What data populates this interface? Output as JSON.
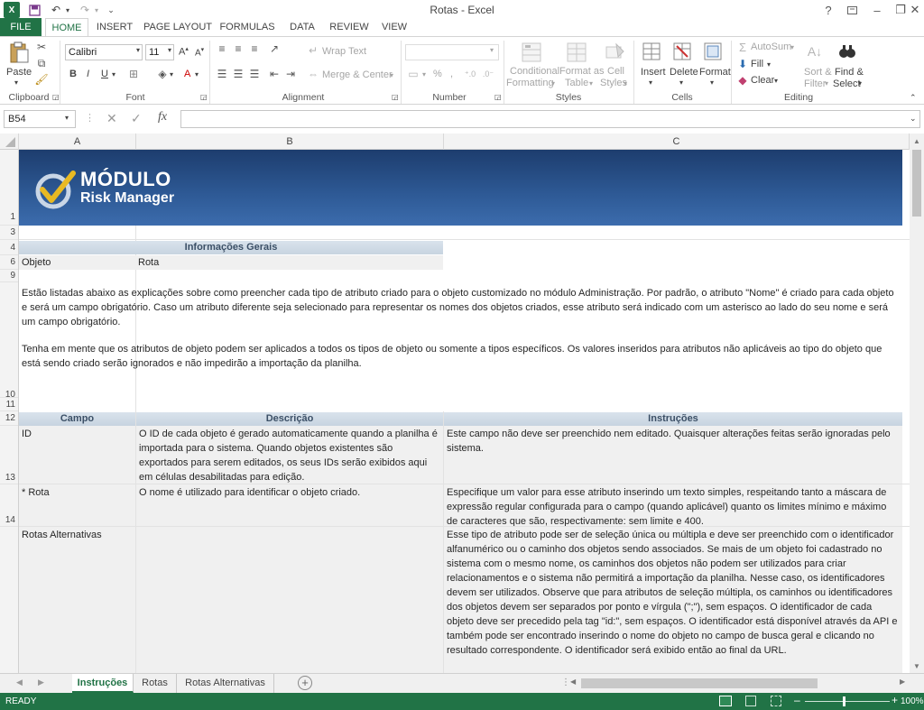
{
  "window": {
    "title": "Rotas - Excel"
  },
  "ribbon_tabs": [
    "FILE",
    "HOME",
    "INSERT",
    "PAGE LAYOUT",
    "FORMULAS",
    "DATA",
    "REVIEW",
    "VIEW"
  ],
  "clipboard": {
    "paste": "Paste",
    "label": "Clipboard"
  },
  "font": {
    "name": "Calibri",
    "size": "11",
    "bold": "B",
    "italic": "I",
    "underline": "U",
    "label": "Font"
  },
  "alignment": {
    "wrap_text": "Wrap Text",
    "merge_center": "Merge & Center",
    "label": "Alignment"
  },
  "number": {
    "percent": "%",
    "comma": ",",
    "label": "Number"
  },
  "styles": {
    "conditional": "Conditional",
    "formatting": "Formatting",
    "format_as": "Format as",
    "table": "Table",
    "cell": "Cell",
    "cell_styles": "Styles",
    "label": "Styles"
  },
  "cells": {
    "insert": "Insert",
    "delete": "Delete",
    "format": "Format",
    "label": "Cells"
  },
  "editing": {
    "autosum": "AutoSum",
    "fill": "Fill",
    "clear": "Clear",
    "sort": "Sort &",
    "filter": "Filter",
    "find": "Find &",
    "select": "Select",
    "label": "Editing"
  },
  "formula_bar": {
    "name_box": "B54",
    "fx": "fx",
    "value": ""
  },
  "columns": [
    "A",
    "B",
    "C"
  ],
  "rows": [
    "1",
    "3",
    "4",
    "6",
    "9",
    "10",
    "11",
    "12",
    "13",
    "14"
  ],
  "logo": {
    "line1": "MÓDULO",
    "line2": "Risk Manager"
  },
  "info": {
    "header": "Informações Gerais",
    "objeto_label": "Objeto",
    "objeto_value": "Rota"
  },
  "intro": {
    "p1": "Estão listadas abaixo as explicações sobre como preencher cada tipo de atributo criado para o objeto customizado no módulo Administração. Por padrão, o atributo \"Nome\" é criado para cada objeto e será um campo obrigatório. Caso um atributo diferente seja selecionado para representar os nomes dos objetos criados, esse atributo será indicado com um asterisco ao lado do seu nome e será um campo obrigatório.",
    "p2": "Tenha em mente que os atributos de objeto podem ser aplicados a todos os tipos de objeto ou somente a tipos específicos. Os valores inseridos para atributos não aplicáveis ao tipo do objeto que está sendo criado serão ignorados e não impedirão a importação da planilha."
  },
  "table": {
    "headers": [
      "Campo",
      "Descrição",
      "Instruções"
    ],
    "rows": [
      {
        "campo": "ID",
        "descricao": "O ID de cada objeto é gerado automaticamente quando a planilha é importada para o sistema. Quando objetos existentes são exportados para serem editados, os seus IDs serão exibidos aqui em células desabilitadas para edição.",
        "instrucoes": "Este campo não deve ser preenchido nem editado. Quaisquer alterações feitas serão ignoradas pelo sistema."
      },
      {
        "campo": "* Rota",
        "descricao": "O nome é utilizado para identificar o objeto criado.",
        "instrucoes": "Especifique um valor para esse atributo inserindo um texto simples, respeitando tanto a máscara de expressão regular configurada para o campo (quando aplicável) quanto os limites mínimo e máximo de caracteres que são, respectivamente: sem limite e 400."
      },
      {
        "campo": "Rotas Alternativas",
        "descricao": "",
        "instrucoes": "Esse tipo de atributo pode ser de seleção única ou múltipla e deve ser preenchido com o identificador alfanumérico ou o caminho dos objetos sendo associados. Se mais de um objeto foi cadastrado no sistema com o mesmo nome, os caminhos dos objetos não podem ser utilizados para criar relacionamentos e o sistema não permitirá a importação da planilha. Nesse caso, os identificadores devem ser utilizados. Observe que para atributos de seleção múltipla, os caminhos ou identificadores dos objetos devem ser separados por ponto e vírgula (\";\"), sem espaços. O identificador de cada objeto deve ser precedido pela tag \"id:\", sem espaços. O identificador está disponível através da API e também pode ser encontrado inserindo o nome do objeto no campo de busca geral e clicando no resultado correspondente. O identificador será exibido então ao final da URL."
      }
    ]
  },
  "sheet_tabs": [
    "Instruções",
    "Rotas",
    "Rotas Alternativas"
  ],
  "status": {
    "ready": "READY",
    "zoom": "100%"
  },
  "colors": {
    "excel_green": "#217346",
    "header_blue": "#d9e3ec"
  }
}
